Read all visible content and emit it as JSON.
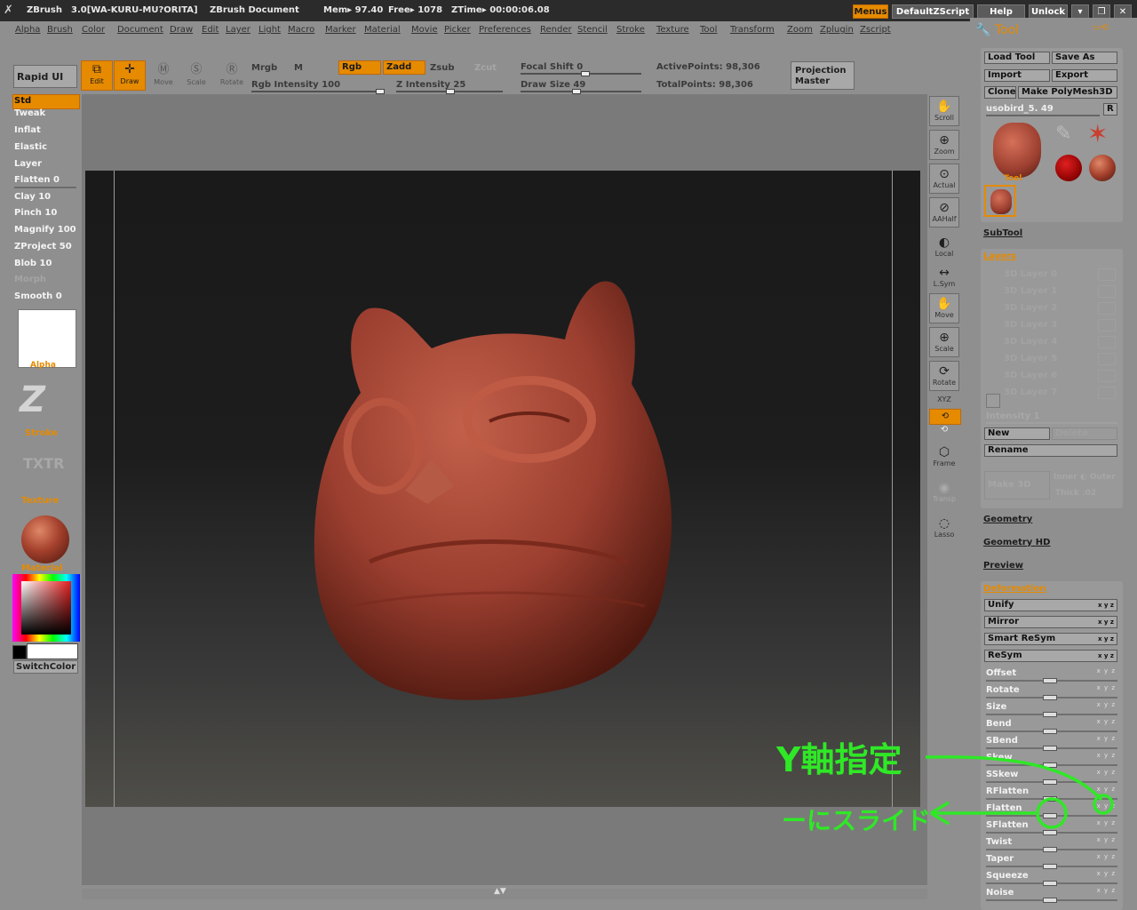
{
  "title_bar": {
    "app": "ZBrush",
    "project": "3.0[WA-KURU-MU?ORITA]",
    "document": "ZBrush Document",
    "mem": "Mem▸ 97.40",
    "free": "Free▸ 1078",
    "ztime": "ZTime▸ 00:00:06.08",
    "menus_btn": "Menus",
    "script_btn": "DefaultZScript",
    "help_btn": "Help",
    "unlock_btn": "Unlock"
  },
  "menu_bar": [
    "Alpha",
    "Brush",
    "Color",
    "Document",
    "Draw",
    "Edit",
    "Layer",
    "Light",
    "Macro",
    "Marker",
    "Material",
    "Movie",
    "Picker",
    "Preferences",
    "Render",
    "Stencil",
    "Stroke",
    "Texture",
    "Tool",
    "Transform",
    "Zoom",
    "Zplugin",
    "Zscript"
  ],
  "shelf": {
    "rapid_ui": "Rapid UI",
    "edit": "Edit",
    "draw": "Draw",
    "move": "Move",
    "scale": "Scale",
    "rotate": "Rotate",
    "mrgb": "Mrgb",
    "m": "M",
    "rgb": "Rgb",
    "zadd": "Zadd",
    "zsub": "Zsub",
    "zcut": "Zcut",
    "rgb_intensity": "Rgb Intensity 100",
    "z_intensity": "Z Intensity 25",
    "focal_shift": "Focal Shift 0",
    "draw_size": "Draw Size 49",
    "active_points": "ActivePoints: 98,306",
    "total_points": "TotalPoints: 98,306",
    "projection_master": [
      "Projection",
      "Master"
    ]
  },
  "left_tray": {
    "brushes": [
      "Std",
      "Tweak",
      "Inflat",
      "Elastic",
      "Layer",
      "Flatten 0",
      "Clay 10",
      "Pinch 10",
      "Magnify 100",
      "ZProject 50",
      "Blob 10",
      "Morph",
      "Smooth 0"
    ],
    "alpha": "Alpha",
    "stroke": "Stroke",
    "texture_logo": "TXTR",
    "texture": "Texture",
    "material": "Material",
    "switch_color": "SwitchColor"
  },
  "right_strip": [
    {
      "label": "Scroll",
      "icon": "hand-icon"
    },
    {
      "label": "Zoom",
      "icon": "zoom-icon"
    },
    {
      "label": "Actual",
      "icon": "actual-size-icon"
    },
    {
      "label": "AAHalf",
      "icon": "aahalf-icon"
    },
    {
      "label": "Local",
      "icon": "local-icon"
    },
    {
      "label": "L.Sym",
      "icon": "symmetry-icon"
    },
    {
      "label": "Move",
      "icon": "move-icon"
    },
    {
      "label": "Scale",
      "icon": "scale-icon"
    },
    {
      "label": "Rotate",
      "icon": "rotate-icon"
    },
    {
      "label": "XYZ",
      "icon": "xyz-icon"
    },
    {
      "label": "Frame",
      "icon": "frame-icon"
    },
    {
      "label": "Transp",
      "icon": "transp-icon"
    },
    {
      "label": "Lasso",
      "icon": "lasso-icon"
    }
  ],
  "tool_panel": {
    "title": "Tool",
    "load_tool": "Load Tool",
    "save_as": "Save As",
    "import": "Import",
    "export": "Export",
    "clone": "Clone",
    "make_polymesh": "Make PolyMesh3D",
    "tool_name": "usobird_5. 49",
    "r": "R",
    "tool_label": "Tool",
    "subtool": "SubTool",
    "layers": "Layers",
    "layer_rows": [
      "3D Layer 0",
      "3D Layer 1",
      "3D Layer 2",
      "3D Layer 3",
      "3D Layer 4",
      "3D Layer 5",
      "3D Layer 6",
      "3D Layer 7"
    ],
    "intensity": "Intensity 1",
    "new": "New",
    "delete": "Delete",
    "rename": "Rename",
    "make_3d": "Make 3D",
    "inner_outer": "Inner ◐ Outer",
    "thick": "Thick .02",
    "geometry": "Geometry",
    "geometry_hd": "Geometry HD",
    "preview": "Preview",
    "deformation": "Deformation",
    "def_buttons": [
      "Unify",
      "Mirror",
      "Smart ReSym",
      "ReSym"
    ],
    "def_sliders": [
      "Offset",
      "Rotate",
      "Size",
      "Bend",
      "SBend",
      "Skew",
      "SSkew",
      "RFlatten",
      "Flatten",
      "SFlatten",
      "Twist",
      "Taper",
      "Squeeze",
      "Noise"
    ],
    "xyz": "x y z"
  },
  "annotations": {
    "y_axis": "Y軸指定",
    "slide": "ーにスライド"
  },
  "colors": {
    "accent": "#e68a00",
    "panel": "#8f8f8f",
    "model": "#9c3f30",
    "annotation": "#2fe826"
  }
}
